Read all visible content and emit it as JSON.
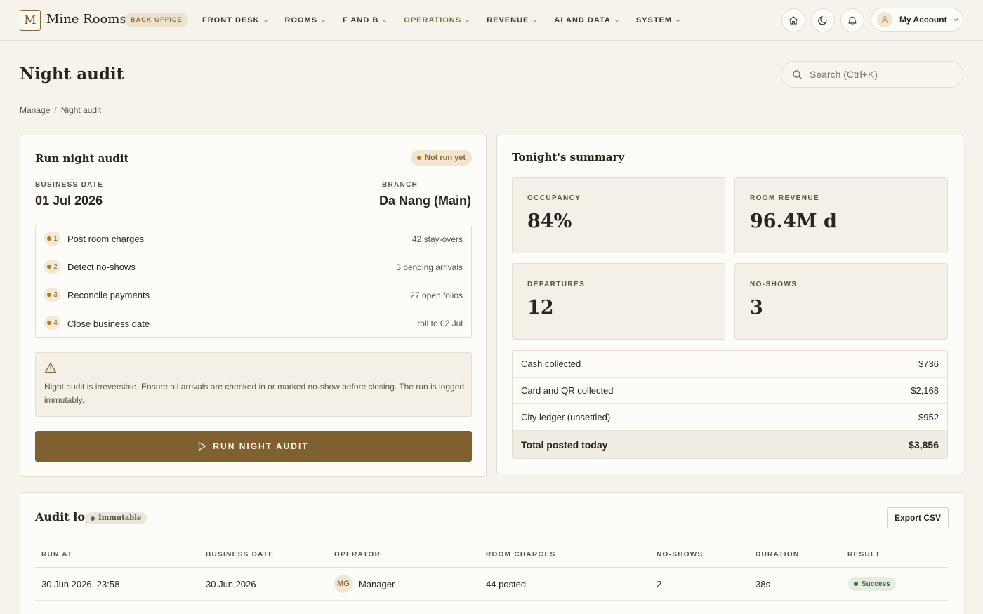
{
  "brand": {
    "logo_letter": "M",
    "name": "Mine Rooms",
    "badge": "BACK OFFICE"
  },
  "nav": {
    "items": [
      {
        "label": "FRONT DESK",
        "active": false
      },
      {
        "label": "ROOMS",
        "active": false
      },
      {
        "label": "F AND B",
        "active": false
      },
      {
        "label": "OPERATIONS",
        "active": true
      },
      {
        "label": "REVENUE",
        "active": false
      },
      {
        "label": "AI AND DATA",
        "active": false
      },
      {
        "label": "SYSTEM",
        "active": false
      }
    ],
    "icons": [
      "home-icon",
      "moon-icon",
      "bell-icon"
    ],
    "account_label": "My Account"
  },
  "page": {
    "title": "Night audit",
    "search_placeholder": "Search (Ctrl+K)",
    "breadcrumb": [
      "Manage",
      "Night audit"
    ],
    "breadcrumb_sep": "/"
  },
  "run_audit": {
    "title": "Run night audit",
    "status": "Not run yet",
    "business_date_label": "BUSINESS DATE",
    "business_date": "01 Jul 2026",
    "branch_label": "BRANCH",
    "branch": "Da Nang (Main)",
    "steps": [
      {
        "num": "1",
        "label": "Post room charges",
        "meta": "42 stay-overs"
      },
      {
        "num": "2",
        "label": "Detect no-shows",
        "meta": "3 pending arrivals"
      },
      {
        "num": "3",
        "label": "Reconcile payments",
        "meta": "27 open folios"
      },
      {
        "num": "4",
        "label": "Close business date",
        "meta": "roll to 02 Jul"
      }
    ],
    "warning": "Night audit is irreversible. Ensure all arrivals are checked in or marked no-show before closing. The run is logged immutably.",
    "button_label": "RUN NIGHT AUDIT"
  },
  "summary": {
    "title": "Tonight's summary",
    "tiles": [
      {
        "label": "OCCUPANCY",
        "value": "84%"
      },
      {
        "label": "ROOM REVENUE",
        "value": "96.4M d"
      },
      {
        "label": "DEPARTURES",
        "value": "12"
      },
      {
        "label": "NO-SHOWS",
        "value": "3"
      }
    ],
    "totals": [
      {
        "label": "Cash collected",
        "value": "$736"
      },
      {
        "label": "Card and QR collected",
        "value": "$2,168"
      },
      {
        "label": "City ledger (unsettled)",
        "value": "$952"
      },
      {
        "label": "Total posted today",
        "value": "$3,856"
      }
    ]
  },
  "audit_log": {
    "title": "Audit log",
    "badge": "Immutable",
    "export_label": "Export CSV",
    "columns": [
      "RUN AT",
      "BUSINESS DATE",
      "OPERATOR",
      "ROOM CHARGES",
      "NO-SHOWS",
      "DURATION",
      "RESULT"
    ],
    "rows": [
      {
        "run_at": "30 Jun 2026, 23:58",
        "business_date": "30 Jun 2026",
        "operator_initials": "MG",
        "operator": "Manager",
        "room_charges": "44 posted",
        "no_shows": "2",
        "duration": "38s",
        "result": "Success"
      }
    ]
  },
  "colors": {
    "accent": "#80602f",
    "background": "#f6f3ec",
    "card": "#fdfcf8",
    "success": "#3e6b3a",
    "warn_dot": "#b07a1c"
  }
}
